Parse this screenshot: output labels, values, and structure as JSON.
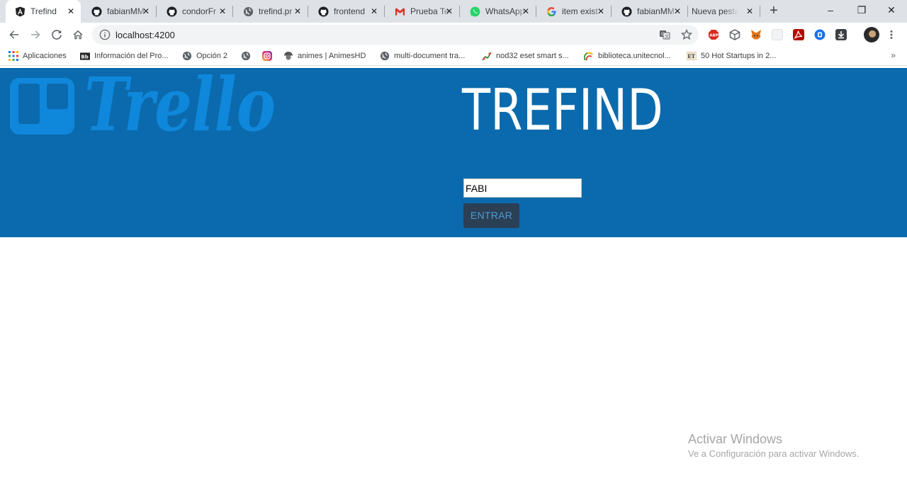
{
  "browser": {
    "tabs": [
      {
        "label": "Trefind",
        "icon": "angular-icon",
        "active": true
      },
      {
        "label": "fabianMM",
        "icon": "github-icon"
      },
      {
        "label": "condorFr",
        "icon": "github-icon"
      },
      {
        "label": "trefind.pr",
        "icon": "globe-icon"
      },
      {
        "label": "frontend",
        "icon": "github-icon"
      },
      {
        "label": "Prueba Te",
        "icon": "gmail-icon"
      },
      {
        "label": "WhatsApp",
        "icon": "whatsapp-icon"
      },
      {
        "label": "item exist",
        "icon": "google-icon"
      },
      {
        "label": "fabianMM",
        "icon": "github-icon"
      },
      {
        "label": "Nueva pestaña",
        "icon": ""
      }
    ],
    "new_tab_glyph": "+",
    "window_controls": {
      "minimize": "–",
      "restore": "❐",
      "close": "✕"
    },
    "address": {
      "url": "localhost:4200"
    },
    "bookmarks": [
      {
        "label": "Aplicaciones",
        "icon": "apps-grid-icon"
      },
      {
        "label": "Información del Pro...",
        "icon": "bb-icon"
      },
      {
        "label": "Opción 2",
        "icon": "globe-icon"
      },
      {
        "label": "",
        "icon": "globe-icon"
      },
      {
        "label": "",
        "icon": "instagram-icon"
      },
      {
        "label": "animes | AnimesHD",
        "icon": "anime-icon"
      },
      {
        "label": "multi-document tra...",
        "icon": "globe-icon"
      },
      {
        "label": "nod32 eset smart s...",
        "icon": "chart-icon"
      },
      {
        "label": "biblioteca.unitecnol...",
        "icon": "arc-icon"
      },
      {
        "label": "50 Hot Startups in 2...",
        "icon": "et-icon"
      }
    ],
    "bookmarks_more": "»"
  },
  "app": {
    "title": "TREFIND",
    "logo_text": "Trello",
    "name_input_value": "FABI",
    "enter_button_label": "ENTRAR"
  },
  "windows_watermark": {
    "title": "Activar Windows",
    "subtitle": "Ve a Configuración para activar Windows."
  },
  "colors": {
    "hero_bg": "#0b6aad",
    "logo": "#0f87db",
    "button_bg": "#2b3f55",
    "button_text": "#4a9cd6"
  }
}
